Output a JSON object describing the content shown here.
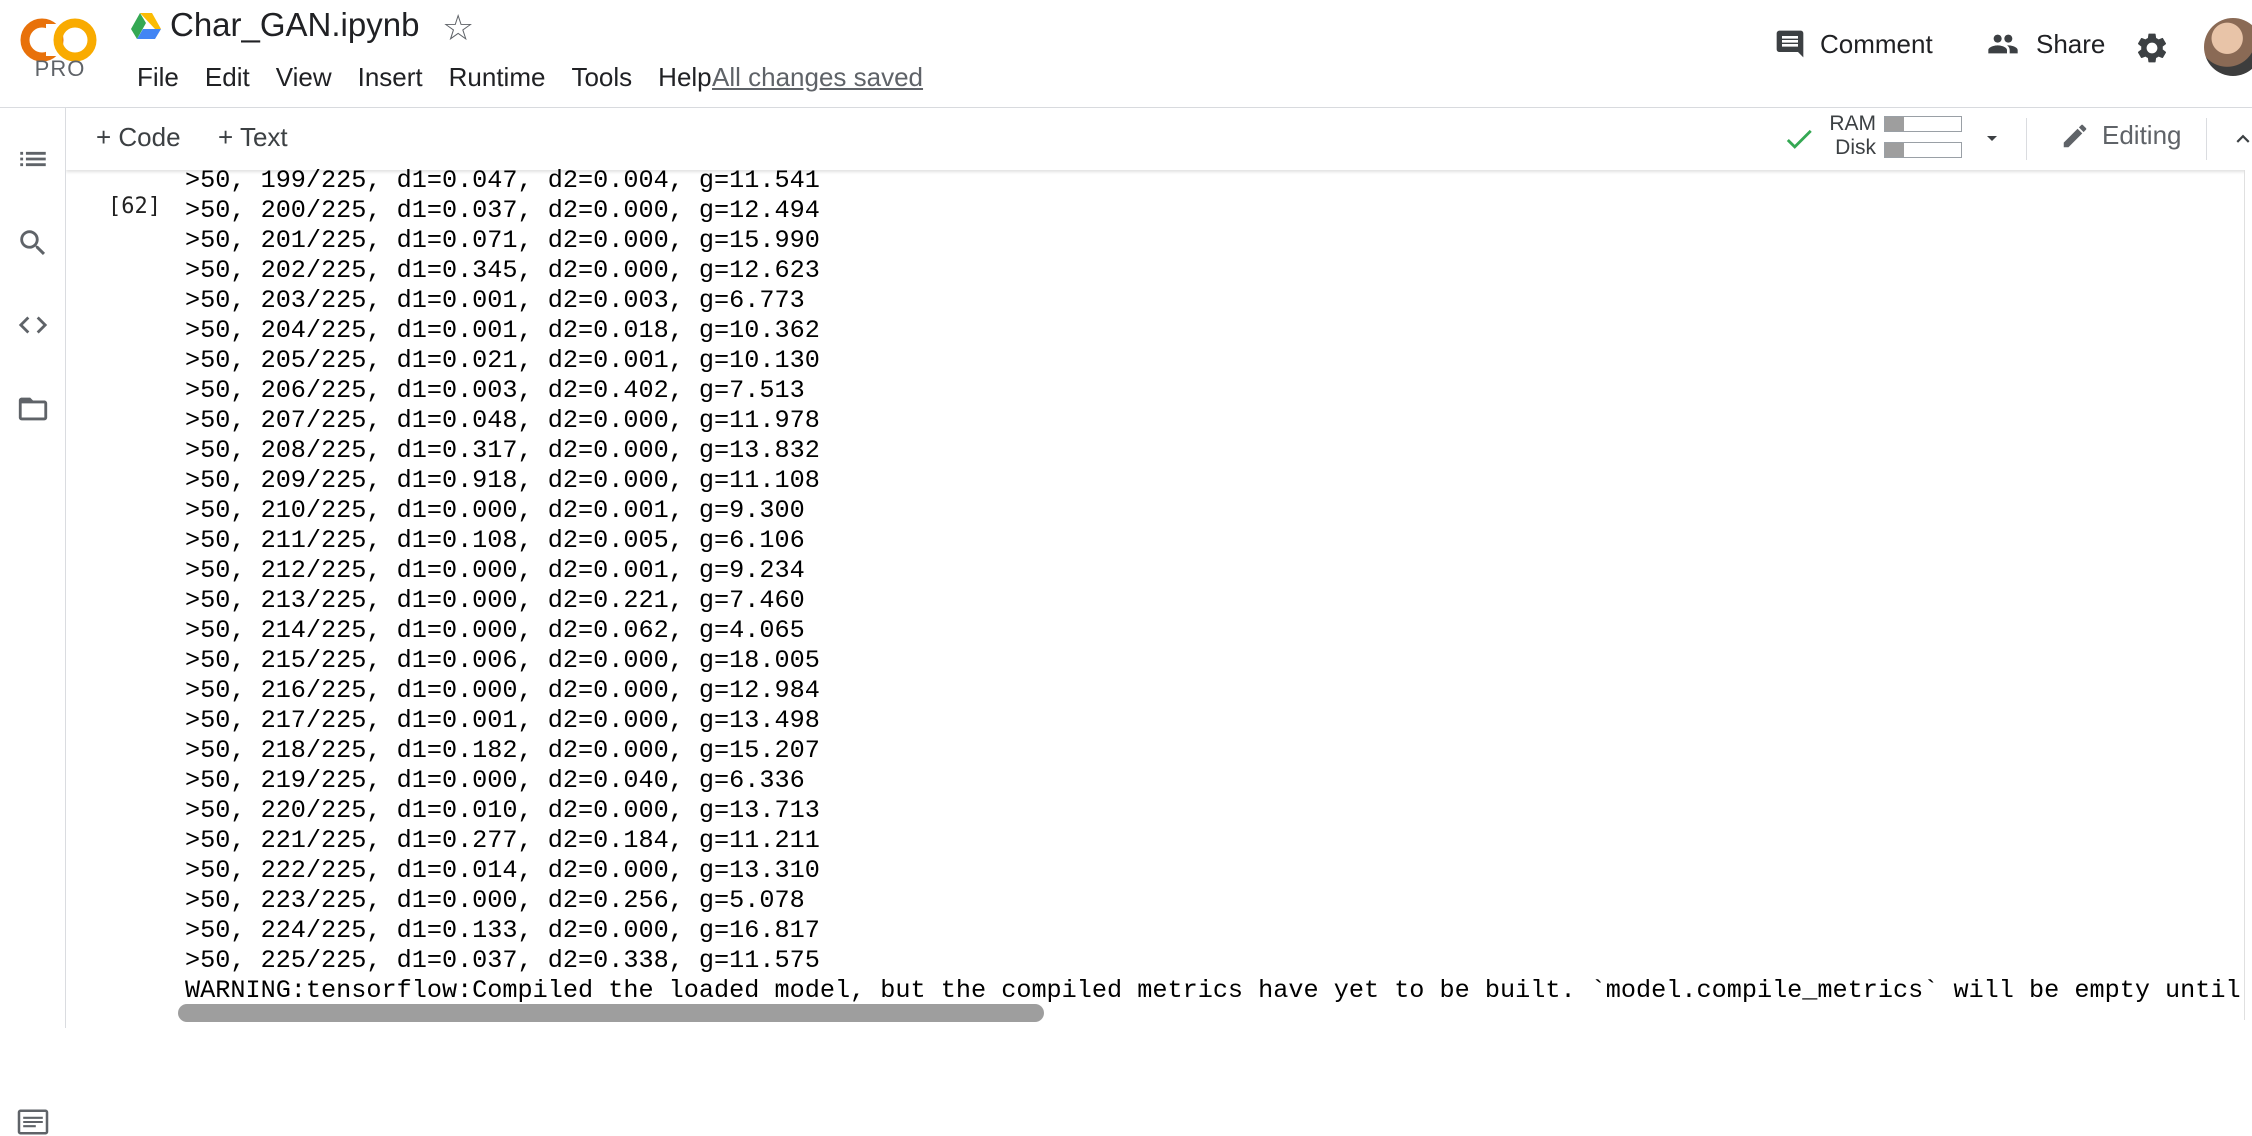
{
  "header": {
    "logo_text": "CO",
    "pro_label": "PRO",
    "notebook_title": "Char_GAN.ipynb",
    "menu": [
      "File",
      "Edit",
      "View",
      "Insert",
      "Runtime",
      "Tools",
      "Help"
    ],
    "save_status": "All changes saved",
    "comment_label": "Comment",
    "share_label": "Share"
  },
  "toolbar": {
    "add_code_label": "+ Code",
    "add_text_label": "+ Text",
    "ram_label": "RAM",
    "disk_label": "Disk",
    "ram_usage_fraction": 0.25,
    "disk_usage_fraction": 0.25,
    "editing_label": "Editing"
  },
  "colors": {
    "logo_orange": "#F9AB00",
    "logo_orange_dark": "#E8710A",
    "check_green": "#34A853",
    "icon_grey": "#5f6368"
  },
  "cell": {
    "execution_count": "[62]",
    "output_lines": [
      ">50, 199/225, d1=0.047, d2=0.004, g=11.541",
      ">50, 200/225, d1=0.037, d2=0.000, g=12.494",
      ">50, 201/225, d1=0.071, d2=0.000, g=15.990",
      ">50, 202/225, d1=0.345, d2=0.000, g=12.623",
      ">50, 203/225, d1=0.001, d2=0.003, g=6.773",
      ">50, 204/225, d1=0.001, d2=0.018, g=10.362",
      ">50, 205/225, d1=0.021, d2=0.001, g=10.130",
      ">50, 206/225, d1=0.003, d2=0.402, g=7.513",
      ">50, 207/225, d1=0.048, d2=0.000, g=11.978",
      ">50, 208/225, d1=0.317, d2=0.000, g=13.832",
      ">50, 209/225, d1=0.918, d2=0.000, g=11.108",
      ">50, 210/225, d1=0.000, d2=0.001, g=9.300",
      ">50, 211/225, d1=0.108, d2=0.005, g=6.106",
      ">50, 212/225, d1=0.000, d2=0.001, g=9.234",
      ">50, 213/225, d1=0.000, d2=0.221, g=7.460",
      ">50, 214/225, d1=0.000, d2=0.062, g=4.065",
      ">50, 215/225, d1=0.006, d2=0.000, g=18.005",
      ">50, 216/225, d1=0.000, d2=0.000, g=12.984",
      ">50, 217/225, d1=0.001, d2=0.000, g=13.498",
      ">50, 218/225, d1=0.182, d2=0.000, g=15.207",
      ">50, 219/225, d1=0.000, d2=0.040, g=6.336",
      ">50, 220/225, d1=0.010, d2=0.000, g=13.713",
      ">50, 221/225, d1=0.277, d2=0.184, g=11.211",
      ">50, 222/225, d1=0.014, d2=0.000, g=13.310",
      ">50, 223/225, d1=0.000, d2=0.256, g=5.078",
      ">50, 224/225, d1=0.133, d2=0.000, g=16.817",
      ">50, 225/225, d1=0.037, d2=0.338, g=11.575"
    ],
    "warning_line": "WARNING:tensorflow:Compiled the loaded model, but the compiled metrics have yet to be built. `model.compile_metrics` will be empty until"
  },
  "icons": {
    "rail": [
      "table-of-contents-icon",
      "search-icon",
      "code-snippets-icon",
      "files-icon"
    ],
    "bottom": "terminal-icon"
  }
}
